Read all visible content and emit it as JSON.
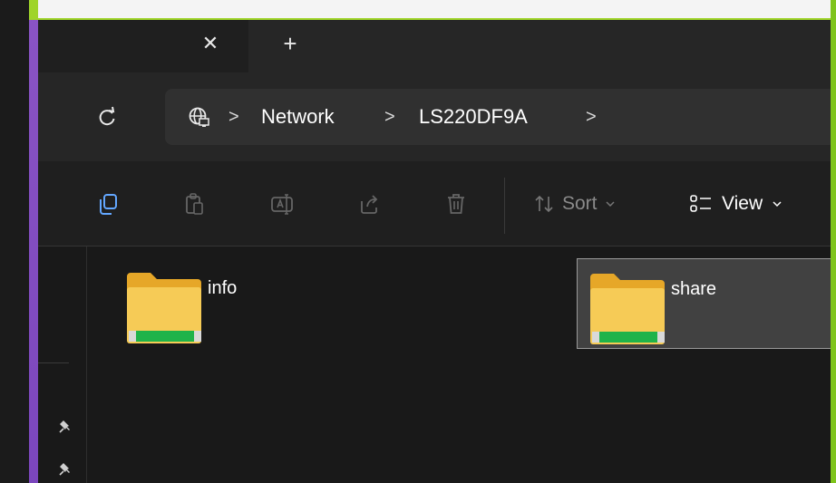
{
  "titlebar": {
    "close_tab_glyph": "✕",
    "new_tab_glyph": "+"
  },
  "address": {
    "refresh_icon": "refresh-icon",
    "location_icon": "network-globe-icon",
    "breadcrumbs": [
      "Network",
      "LS220DF9A"
    ],
    "separator": ">"
  },
  "toolbar": {
    "sort_label": "Sort",
    "view_label": "View",
    "icons": [
      "copy-icon",
      "paste-icon",
      "rename-icon",
      "share-icon",
      "delete-icon"
    ]
  },
  "files": [
    {
      "name": "info",
      "selected": false
    },
    {
      "name": "share",
      "selected": true
    }
  ],
  "colors": {
    "folder_yellow": "#f8c94a",
    "share_green": "#24b74a",
    "selection_bg": "#414141",
    "accent_blue": "#63a7ff"
  }
}
